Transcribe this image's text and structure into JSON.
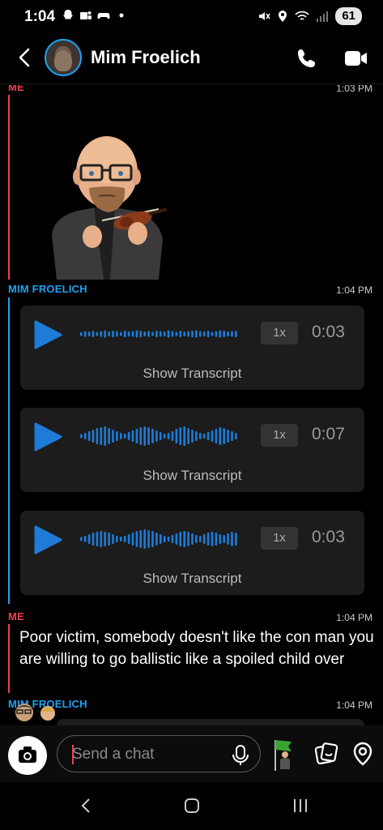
{
  "status_bar": {
    "time": "1:04",
    "battery": "61"
  },
  "header": {
    "contact_name": "Mim Froelich"
  },
  "messages": [
    {
      "sender": "ME",
      "time": "1:03 PM",
      "type": "bitmoji"
    },
    {
      "sender": "MIM FROELICH",
      "time": "1:04 PM",
      "type": "voice_notes",
      "notes": [
        {
          "speed": "1x",
          "duration": "0:03",
          "transcript_label": "Show Transcript"
        },
        {
          "speed": "1x",
          "duration": "0:07",
          "transcript_label": "Show Transcript"
        },
        {
          "speed": "1x",
          "duration": "0:03",
          "transcript_label": "Show Transcript"
        }
      ]
    },
    {
      "sender": "ME",
      "time": "1:04 PM",
      "type": "text",
      "text": "Poor victim, somebody doesn't like the con man you are willing to go ballistic like a spoiled child over"
    },
    {
      "sender": "MIM FROELICH",
      "time": "1:04 PM",
      "type": "partial"
    }
  ],
  "composer": {
    "placeholder": "Send a chat"
  },
  "colors": {
    "me": "#f23c57",
    "them": "#1ea1f2",
    "bubble": "#1c1c1c"
  },
  "icons": [
    "back-arrow-icon",
    "phone-icon",
    "video-icon",
    "play-icon",
    "camera-icon",
    "microphone-icon",
    "bitmoji-icon",
    "sticker-icon",
    "location-icon"
  ]
}
